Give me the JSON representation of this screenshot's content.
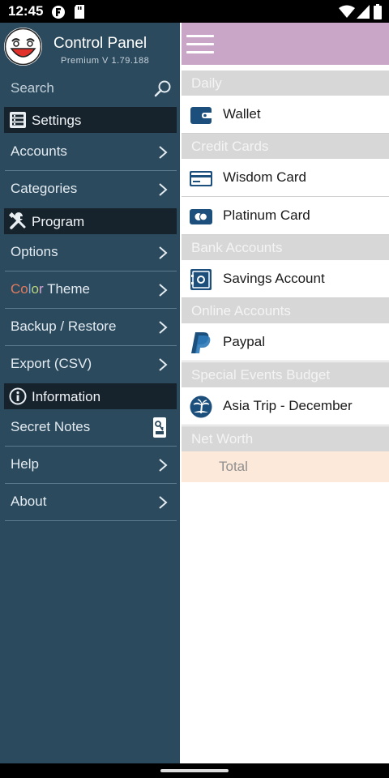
{
  "status_bar": {
    "time": "12:45",
    "icons": [
      "firefox-focus-icon",
      "sd-card-icon",
      "wifi-icon",
      "cellular-icon",
      "battery-icon"
    ]
  },
  "drawer": {
    "app_title": "Control Panel",
    "version": "Premium  V  1.79.188",
    "search_label": "Search",
    "sections": {
      "settings": "Settings",
      "program": "Program",
      "information": "Information"
    },
    "items": {
      "accounts": "Accounts",
      "categories": "Categories",
      "options": "Options",
      "color_theme": {
        "c1": "Co",
        "c2": "l",
        "c3": "o",
        "c4": "r",
        "rest": " Theme"
      },
      "backup_restore": "Backup / Restore",
      "export_csv": "Export (CSV)",
      "secret_notes": "Secret Notes",
      "help": "Help",
      "about": "About"
    }
  },
  "content": {
    "groups": {
      "daily": "Daily",
      "credit_cards": "Credit Cards",
      "bank_accounts": "Bank Accounts",
      "online_accounts": "Online Accounts",
      "special_events": "Special Events Budget",
      "net_worth": "Net Worth"
    },
    "accounts": {
      "wallet": "Wallet",
      "wisdom_card": "Wisdom Card",
      "platinum_card": "Platinum Card",
      "savings_account": "Savings Account",
      "paypal": "Paypal",
      "asia_trip": "Asia Trip - December"
    },
    "total_label": "Total"
  },
  "colors": {
    "drawer_bg": "#2c4a5e",
    "section_bg": "#17232c",
    "appbar_bg": "#c9a5c8",
    "group_header_bg": "#d7d7d7",
    "total_bg": "#fde9d9",
    "icon_blue": "#1d4f7c"
  }
}
